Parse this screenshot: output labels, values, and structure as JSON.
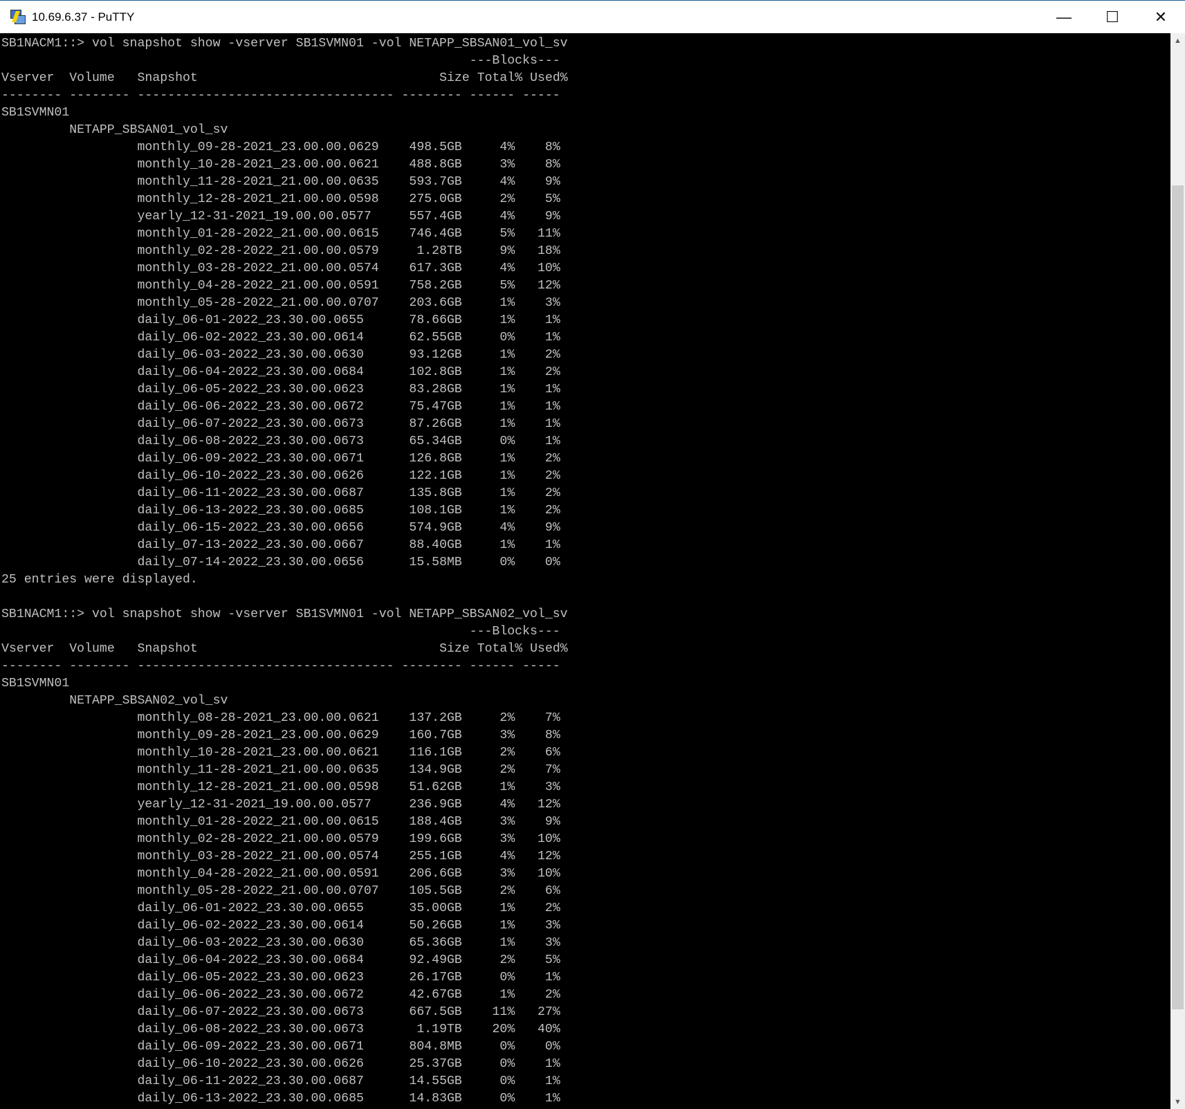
{
  "window": {
    "title": "10.69.6.37 - PuTTY",
    "minimize": "—",
    "maximize": "☐",
    "close": "✕"
  },
  "scrollbar": {
    "up": "▲",
    "down": "▼"
  },
  "header": {
    "blocks": "---Blocks---",
    "vserver": "Vserver",
    "volume": "Volume",
    "snapshot": "Snapshot",
    "size": "Size",
    "total": "Total%",
    "used": "Used%",
    "dashes": "-------- -------- ---------------------------------- -------- ------ -----"
  },
  "sections": [
    {
      "prompt": "SB1NACM1::> vol snapshot show -vserver SB1SVMN01 -vol NETAPP_SBSAN01_vol_sv",
      "vserver": "SB1SVMN01",
      "volume": "NETAPP_SBSAN01_vol_sv",
      "rows": [
        [
          "monthly_09-28-2021_23.00.00.0629",
          "498.5GB",
          "4%",
          "8%"
        ],
        [
          "monthly_10-28-2021_23.00.00.0621",
          "488.8GB",
          "3%",
          "8%"
        ],
        [
          "monthly_11-28-2021_21.00.00.0635",
          "593.7GB",
          "4%",
          "9%"
        ],
        [
          "monthly_12-28-2021_21.00.00.0598",
          "275.0GB",
          "2%",
          "5%"
        ],
        [
          "yearly_12-31-2021_19.00.00.0577",
          "557.4GB",
          "4%",
          "9%"
        ],
        [
          "monthly_01-28-2022_21.00.00.0615",
          "746.4GB",
          "5%",
          "11%"
        ],
        [
          "monthly_02-28-2022_21.00.00.0579",
          "1.28TB",
          "9%",
          "18%"
        ],
        [
          "monthly_03-28-2022_21.00.00.0574",
          "617.3GB",
          "4%",
          "10%"
        ],
        [
          "monthly_04-28-2022_21.00.00.0591",
          "758.2GB",
          "5%",
          "12%"
        ],
        [
          "monthly_05-28-2022_21.00.00.0707",
          "203.6GB",
          "1%",
          "3%"
        ],
        [
          "daily_06-01-2022_23.30.00.0655",
          "78.66GB",
          "1%",
          "1%"
        ],
        [
          "daily_06-02-2022_23.30.00.0614",
          "62.55GB",
          "0%",
          "1%"
        ],
        [
          "daily_06-03-2022_23.30.00.0630",
          "93.12GB",
          "1%",
          "2%"
        ],
        [
          "daily_06-04-2022_23.30.00.0684",
          "102.8GB",
          "1%",
          "2%"
        ],
        [
          "daily_06-05-2022_23.30.00.0623",
          "83.28GB",
          "1%",
          "1%"
        ],
        [
          "daily_06-06-2022_23.30.00.0672",
          "75.47GB",
          "1%",
          "1%"
        ],
        [
          "daily_06-07-2022_23.30.00.0673",
          "87.26GB",
          "1%",
          "1%"
        ],
        [
          "daily_06-08-2022_23.30.00.0673",
          "65.34GB",
          "0%",
          "1%"
        ],
        [
          "daily_06-09-2022_23.30.00.0671",
          "126.8GB",
          "1%",
          "2%"
        ],
        [
          "daily_06-10-2022_23.30.00.0626",
          "122.1GB",
          "1%",
          "2%"
        ],
        [
          "daily_06-11-2022_23.30.00.0687",
          "135.8GB",
          "1%",
          "2%"
        ],
        [
          "daily_06-13-2022_23.30.00.0685",
          "108.1GB",
          "1%",
          "2%"
        ],
        [
          "daily_06-15-2022_23.30.00.0656",
          "574.9GB",
          "4%",
          "9%"
        ],
        [
          "daily_07-13-2022_23.30.00.0667",
          "88.40GB",
          "1%",
          "1%"
        ],
        [
          "daily_07-14-2022_23.30.00.0656",
          "15.58MB",
          "0%",
          "0%"
        ]
      ],
      "footer": "25 entries were displayed."
    },
    {
      "prompt": "SB1NACM1::> vol snapshot show -vserver SB1SVMN01 -vol NETAPP_SBSAN02_vol_sv",
      "vserver": "SB1SVMN01",
      "volume": "NETAPP_SBSAN02_vol_sv",
      "rows": [
        [
          "monthly_08-28-2021_23.00.00.0621",
          "137.2GB",
          "2%",
          "7%"
        ],
        [
          "monthly_09-28-2021_23.00.00.0629",
          "160.7GB",
          "3%",
          "8%"
        ],
        [
          "monthly_10-28-2021_23.00.00.0621",
          "116.1GB",
          "2%",
          "6%"
        ],
        [
          "monthly_11-28-2021_21.00.00.0635",
          "134.9GB",
          "2%",
          "7%"
        ],
        [
          "monthly_12-28-2021_21.00.00.0598",
          "51.62GB",
          "1%",
          "3%"
        ],
        [
          "yearly_12-31-2021_19.00.00.0577",
          "236.9GB",
          "4%",
          "12%"
        ],
        [
          "monthly_01-28-2022_21.00.00.0615",
          "188.4GB",
          "3%",
          "9%"
        ],
        [
          "monthly_02-28-2022_21.00.00.0579",
          "199.6GB",
          "3%",
          "10%"
        ],
        [
          "monthly_03-28-2022_21.00.00.0574",
          "255.1GB",
          "4%",
          "12%"
        ],
        [
          "monthly_04-28-2022_21.00.00.0591",
          "206.6GB",
          "3%",
          "10%"
        ],
        [
          "monthly_05-28-2022_21.00.00.0707",
          "105.5GB",
          "2%",
          "6%"
        ],
        [
          "daily_06-01-2022_23.30.00.0655",
          "35.00GB",
          "1%",
          "2%"
        ],
        [
          "daily_06-02-2022_23.30.00.0614",
          "50.26GB",
          "1%",
          "3%"
        ],
        [
          "daily_06-03-2022_23.30.00.0630",
          "65.36GB",
          "1%",
          "3%"
        ],
        [
          "daily_06-04-2022_23.30.00.0684",
          "92.49GB",
          "2%",
          "5%"
        ],
        [
          "daily_06-05-2022_23.30.00.0623",
          "26.17GB",
          "0%",
          "1%"
        ],
        [
          "daily_06-06-2022_23.30.00.0672",
          "42.67GB",
          "1%",
          "2%"
        ],
        [
          "daily_06-07-2022_23.30.00.0673",
          "667.5GB",
          "11%",
          "27%"
        ],
        [
          "daily_06-08-2022_23.30.00.0673",
          "1.19TB",
          "20%",
          "40%"
        ],
        [
          "daily_06-09-2022_23.30.00.0671",
          "804.8MB",
          "0%",
          "0%"
        ],
        [
          "daily_06-10-2022_23.30.00.0626",
          "25.37GB",
          "0%",
          "1%"
        ],
        [
          "daily_06-11-2022_23.30.00.0687",
          "14.55GB",
          "0%",
          "1%"
        ],
        [
          "daily_06-13-2022_23.30.00.0685",
          "14.83GB",
          "0%",
          "1%"
        ]
      ]
    }
  ]
}
